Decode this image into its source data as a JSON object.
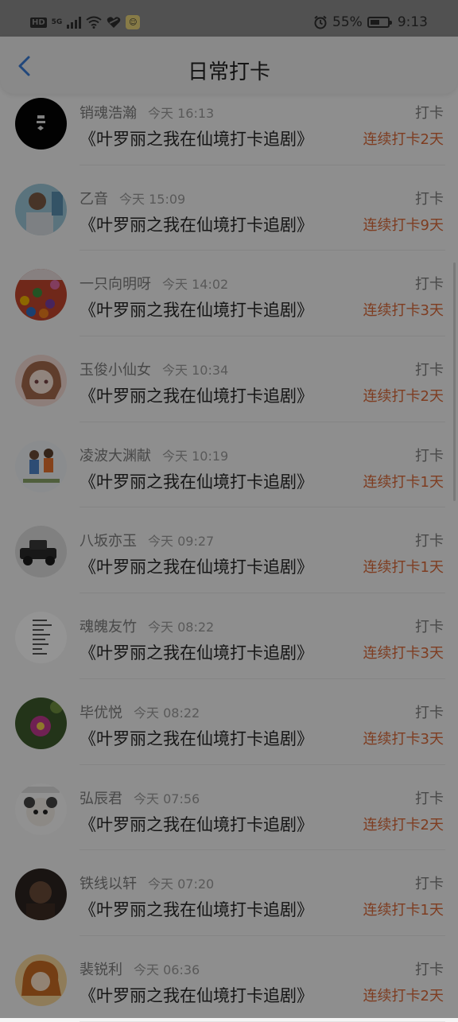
{
  "status_bar": {
    "hd_label": "HD",
    "network": "5G",
    "battery_percent": "55%",
    "battery_level": 0.55,
    "time": "9:13"
  },
  "header": {
    "title": "日常打卡",
    "back_icon": "chevron-left-icon",
    "accent_color": "#3a7bd5"
  },
  "items": [
    {
      "name": "销魂浩瀚",
      "time": "今天 16:13",
      "program": "《叶罗丽之我在仙境打卡追剧》",
      "action": "打卡",
      "streak": "连续打卡2天"
    },
    {
      "name": "乙音",
      "time": "今天 15:09",
      "program": "《叶罗丽之我在仙境打卡追剧》",
      "action": "打卡",
      "streak": "连续打卡9天"
    },
    {
      "name": "一只向明呀",
      "time": "今天 14:02",
      "program": "《叶罗丽之我在仙境打卡追剧》",
      "action": "打卡",
      "streak": "连续打卡3天"
    },
    {
      "name": "玉俊小仙女",
      "time": "今天 10:34",
      "program": "《叶罗丽之我在仙境打卡追剧》",
      "action": "打卡",
      "streak": "连续打卡2天"
    },
    {
      "name": "凌波大渊献",
      "time": "今天 10:19",
      "program": "《叶罗丽之我在仙境打卡追剧》",
      "action": "打卡",
      "streak": "连续打卡1天"
    },
    {
      "name": "八坂亦玉",
      "time": "今天 09:27",
      "program": "《叶罗丽之我在仙境打卡追剧》",
      "action": "打卡",
      "streak": "连续打卡1天"
    },
    {
      "name": "魂魄友竹",
      "time": "今天 08:22",
      "program": "《叶罗丽之我在仙境打卡追剧》",
      "action": "打卡",
      "streak": "连续打卡3天"
    },
    {
      "name": "毕优悦",
      "time": "今天 08:22",
      "program": "《叶罗丽之我在仙境打卡追剧》",
      "action": "打卡",
      "streak": "连续打卡3天"
    },
    {
      "name": "弘辰君",
      "time": "今天 07:56",
      "program": "《叶罗丽之我在仙境打卡追剧》",
      "action": "打卡",
      "streak": "连续打卡2天"
    },
    {
      "name": "铁线以轩",
      "time": "今天 07:20",
      "program": "《叶罗丽之我在仙境打卡追剧》",
      "action": "打卡",
      "streak": "连续打卡1天"
    },
    {
      "name": "裴锐利",
      "time": "今天 06:36",
      "program": "《叶罗丽之我在仙境打卡追剧》",
      "action": "打卡",
      "streak": "连续打卡2天"
    }
  ],
  "colors": {
    "streak": "#d9693a",
    "background": "#f4f4f4"
  }
}
